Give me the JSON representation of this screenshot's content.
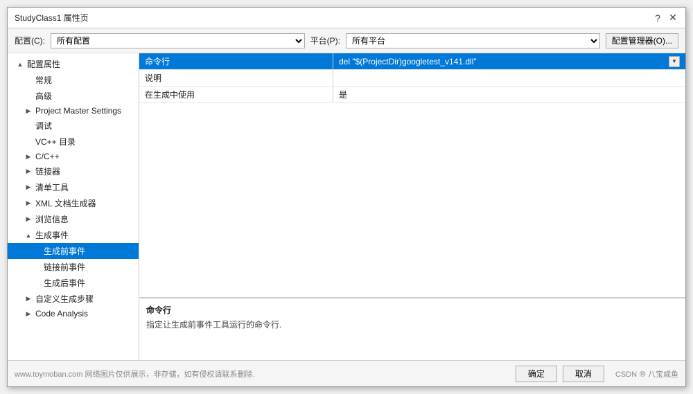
{
  "dialog": {
    "title": "StudyClass1 属性页",
    "title_buttons": [
      "?",
      "✕"
    ]
  },
  "toolbar": {
    "config_label": "配置(C):",
    "config_value": "所有配置",
    "platform_label": "平台(P):",
    "platform_value": "所有平台",
    "manager_btn": "配置管理器(O)..."
  },
  "tree": {
    "items": [
      {
        "id": "root",
        "label": "▲ 配置属性",
        "level": 1,
        "toggle": "▲"
      },
      {
        "id": "general",
        "label": "常规",
        "level": 2,
        "toggle": ""
      },
      {
        "id": "advanced",
        "label": "高级",
        "level": 2,
        "toggle": ""
      },
      {
        "id": "project-master",
        "label": "▶ Project Master Settings",
        "level": 2,
        "toggle": "▶"
      },
      {
        "id": "debug",
        "label": "调试",
        "level": 2,
        "toggle": ""
      },
      {
        "id": "vcpp-dirs",
        "label": "VC++ 目录",
        "level": 2,
        "toggle": ""
      },
      {
        "id": "cpp",
        "label": "▶ C/C++",
        "level": 2,
        "toggle": "▶"
      },
      {
        "id": "linker",
        "label": "▶ 链接器",
        "level": 2,
        "toggle": "▶"
      },
      {
        "id": "manifest",
        "label": "▶ 清单工具",
        "level": 2,
        "toggle": "▶"
      },
      {
        "id": "xml-gen",
        "label": "▶ XML 文档生成器",
        "level": 2,
        "toggle": "▶"
      },
      {
        "id": "browse",
        "label": "▶ 浏览信息",
        "level": 2,
        "toggle": "▶"
      },
      {
        "id": "build-events",
        "label": "▲ 生成事件",
        "level": 2,
        "toggle": "▲"
      },
      {
        "id": "pre-build",
        "label": "生成前事件",
        "level": 3,
        "toggle": "",
        "selected": true
      },
      {
        "id": "link-event",
        "label": "链接前事件",
        "level": 3,
        "toggle": ""
      },
      {
        "id": "post-build",
        "label": "生成后事件",
        "level": 3,
        "toggle": ""
      },
      {
        "id": "custom-build",
        "label": "▶ 自定义生成步骤",
        "level": 2,
        "toggle": "▶"
      },
      {
        "id": "code-analysis",
        "label": "▶ Code Analysis",
        "level": 2,
        "toggle": "▶"
      }
    ]
  },
  "properties": {
    "rows": [
      {
        "id": "command",
        "name": "命令行",
        "value": "del \"$(ProjectDir)googletest_v141.dll\"",
        "selected": true,
        "has_dropdown": true
      },
      {
        "id": "description",
        "name": "说明",
        "value": "",
        "selected": false,
        "has_dropdown": false
      },
      {
        "id": "use-in-build",
        "name": "在生成中使用",
        "value": "是",
        "selected": false,
        "has_dropdown": false
      }
    ]
  },
  "description": {
    "title": "命令行",
    "text": "指定让生成前事件工具运行的命令行."
  },
  "bottom": {
    "watermark": "www.toymoban.com 网络图片仅供展示，非存储，如有侵权请联系删除.",
    "ok_btn": "确定",
    "cancel_btn": "取消",
    "right_label": "CSDN ⑩ 八宝咸鱼"
  }
}
